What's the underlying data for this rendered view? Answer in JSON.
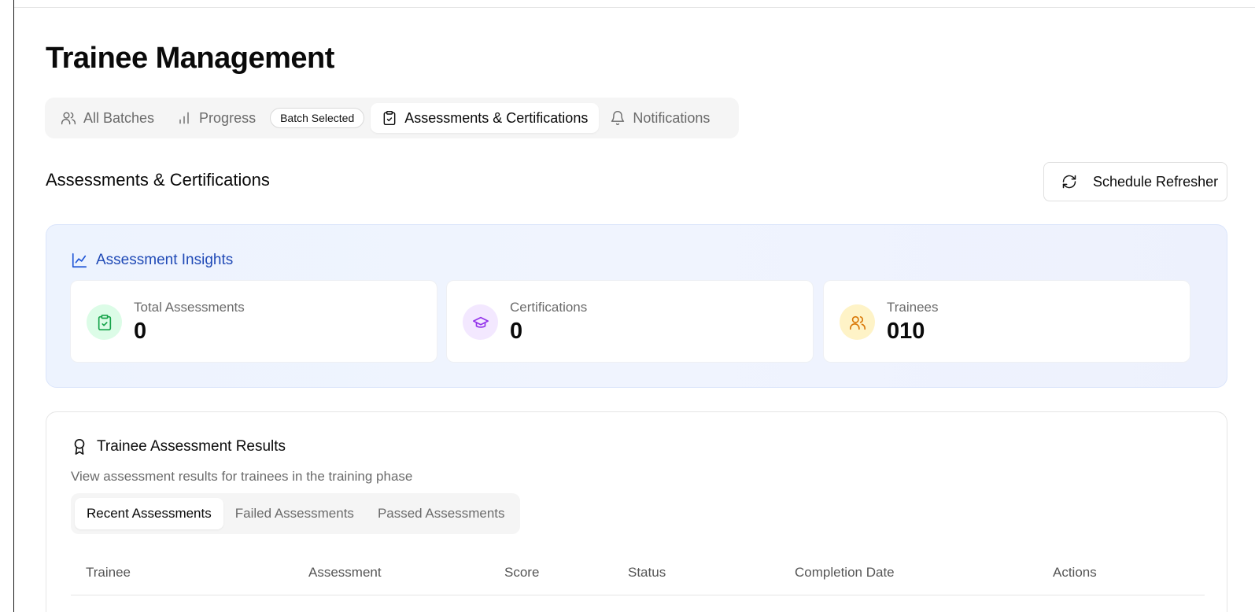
{
  "page": {
    "title": "Trainee Management"
  },
  "tabs": [
    {
      "label": "All Batches",
      "icon": "users-icon"
    },
    {
      "label": "Progress",
      "icon": "bar-chart-icon"
    },
    {
      "label": "Assessments & Certifications",
      "icon": "clipboard-check-icon"
    },
    {
      "label": "Notifications",
      "icon": "bell-icon"
    }
  ],
  "batch_badge": "Batch Selected",
  "section": {
    "title": "Assessments & Certifications"
  },
  "schedule_button": {
    "label": "Schedule Refresher",
    "icon": "refresh-icon"
  },
  "insights": {
    "title": "Assessment Insights",
    "icon": "line-chart-icon",
    "accent": "#1f49b6",
    "stats": [
      {
        "label": "Total Assessments",
        "value": "0",
        "icon": "clipboard-check-icon",
        "color": "#16a34a",
        "bg": "#dcfce7"
      },
      {
        "label": "Certifications",
        "value": "0",
        "icon": "graduation-cap-icon",
        "color": "#9333ea",
        "bg": "#f3e8ff"
      },
      {
        "label": "Trainees",
        "value": "010",
        "icon": "users-icon",
        "color": "#d97706",
        "bg": "#fef3c7"
      }
    ]
  },
  "results": {
    "title": "Trainee Assessment Results",
    "icon": "award-icon",
    "subtitle": "View assessment results for trainees in the training phase",
    "tabs": [
      "Recent Assessments",
      "Failed Assessments",
      "Passed Assessments"
    ],
    "columns": [
      "Trainee",
      "Assessment",
      "Score",
      "Status",
      "Completion Date",
      "Actions"
    ]
  }
}
